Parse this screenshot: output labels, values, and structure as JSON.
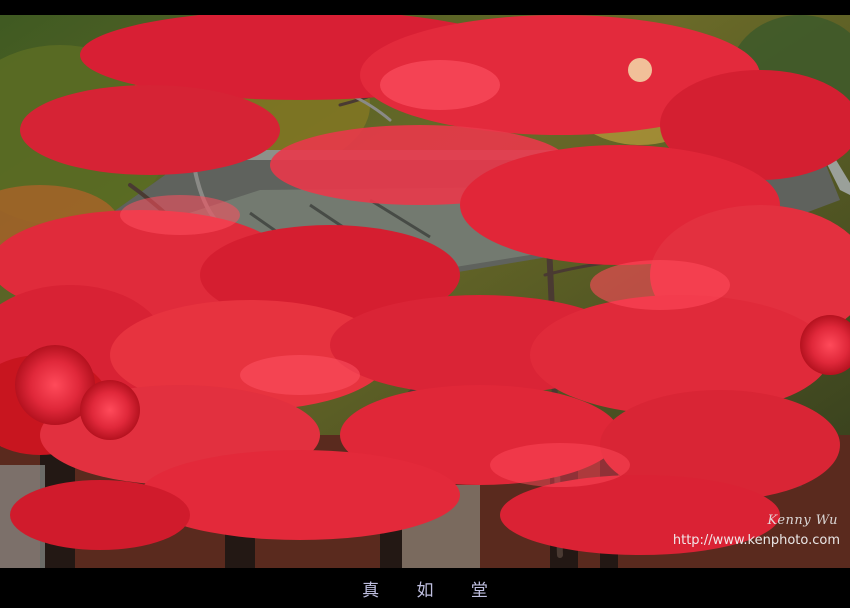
{
  "photo": {
    "subject": "red-maple-over-temple-roof",
    "signature": "Kenny Wu",
    "website": "http://www.kenphoto.com"
  },
  "caption": {
    "text": "真 如 堂"
  },
  "colors": {
    "maple_red": "#e0283a",
    "maple_deep": "#b5121f",
    "roof_gray": "#6c6f6a",
    "background_green": "#4d5e2a",
    "frame": "#000000",
    "caption_text": "#bfbfe0"
  }
}
